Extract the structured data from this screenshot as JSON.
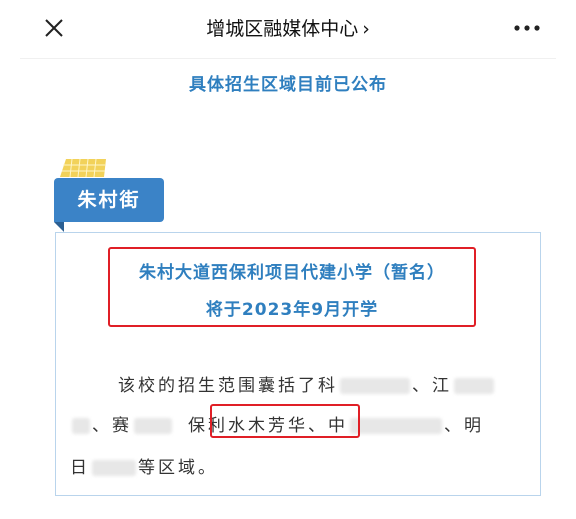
{
  "nav": {
    "title": "增城区融媒体中心",
    "title_chevron": "›",
    "close_icon": "close-icon",
    "more_icon": "more-icon"
  },
  "headline": "具体招生区域目前已公布",
  "badge": "朱村街",
  "card": {
    "school_line1": "朱村大道西保利项目代建小学（暂名）",
    "school_line2": "将于2023年9月开学",
    "para_line1_a": "该校的招生范围囊括了科",
    "para_line1_b": "、江",
    "para_line2_a": "、赛",
    "para_line2_highlight": "保利水木芳华",
    "para_line2_b": "、中",
    "para_line2_c": "、明",
    "para_line3_a": "日",
    "para_line3_b": "等区域。"
  },
  "colors": {
    "accent_blue": "#2f7fbf",
    "badge_blue": "#3b83c7",
    "highlight_red": "#e01f26",
    "deco_yellow": "#f2d25a"
  }
}
